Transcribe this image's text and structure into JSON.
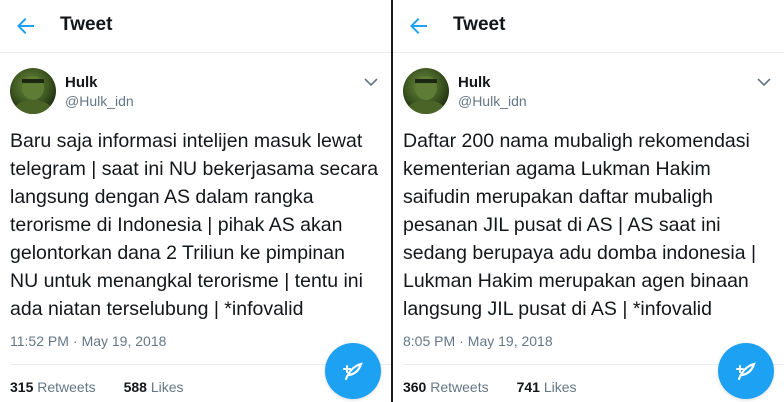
{
  "tweets": [
    {
      "header_title": "Tweet",
      "author_name": "Hulk",
      "author_handle": "@Hulk_idn",
      "lines": [
        "Baru saja informasi intelijen masuk lewat",
        "telegram | saat ini NU bekerjasama secara",
        "langsung dengan AS dalam rangka",
        "terorisme di Indonesia | pihak AS akan",
        "gelontorkan dana 2 Triliun ke pimpinan",
        "NU untuk menangkal terorisme | tentu ini",
        "ada niatan terselubung | *infovalid"
      ],
      "time": "11:52 PM",
      "date": "May 19, 2018",
      "retweets_count": "315",
      "retweets_label": "Retweets",
      "likes_count": "588",
      "likes_label": "Likes"
    },
    {
      "header_title": "Tweet",
      "author_name": "Hulk",
      "author_handle": "@Hulk_idn",
      "lines": [
        "Daftar 200 nama mubaligh rekomendasi",
        "kementerian agama Lukman Hakim",
        "saifudin merupakan daftar mubaligh",
        "pesanan JIL pusat di AS | AS saat ini",
        "sedang berupaya adu domba indonesia |",
        "Lukman Hakim merupakan agen binaan",
        "langsung JIL pusat di AS | *infovalid"
      ],
      "time": "8:05 PM",
      "date": "May 19, 2018",
      "retweets_count": "360",
      "retweets_label": "Retweets",
      "likes_count": "741",
      "likes_label": "Likes"
    }
  ],
  "colors": {
    "accent": "#1da1f2",
    "text": "#14171a",
    "muted": "#657786",
    "border": "#e6ecf0",
    "divider": "#1a1a1a"
  },
  "icons": {
    "back": "back-arrow-icon",
    "menu": "chevron-down-icon",
    "compose": "compose-tweet-icon"
  }
}
